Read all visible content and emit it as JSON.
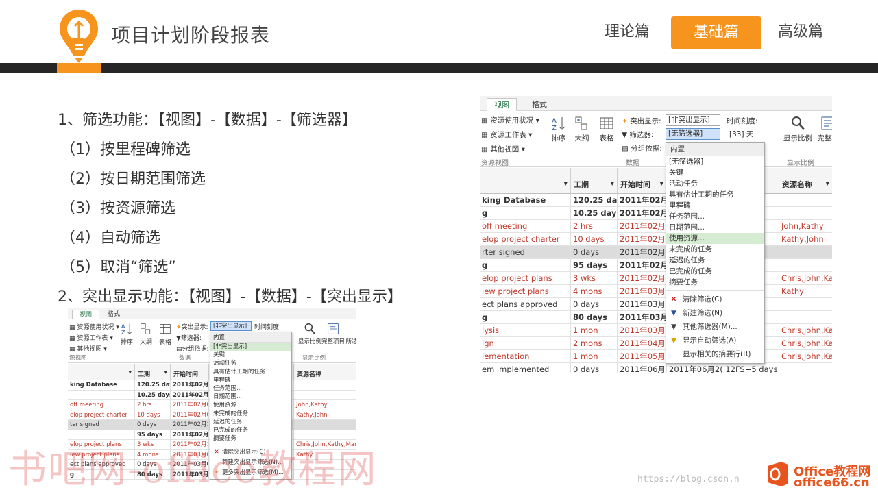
{
  "header": {
    "title": "项目计划阶段报表",
    "nav": [
      "理论篇",
      "基础篇",
      "高级篇"
    ],
    "active_nav": "基础篇"
  },
  "colors": {
    "accent": "#f7941d",
    "band": "#262626",
    "task_red": "#c0392b"
  },
  "content": {
    "line1": "1、筛选功能：【视图】-【数据】-【筛选器】",
    "sub1": "（1）按里程碑筛选",
    "sub2": "（2）按日期范围筛选",
    "sub3": "（3）按资源筛选",
    "sub4": "（4）自动筛选",
    "sub5": "（5）取消“筛选”",
    "line2": "2、突出显示功能：【视图】-【数据】-【突出显示】"
  },
  "shot1": {
    "tabs": [
      "视图",
      "格式"
    ],
    "ribbon": {
      "res_usage": "资源使用状况",
      "res_sheet": "资源工作表",
      "other_views": "其他视图",
      "res_group": "资源视图",
      "sort": "排序",
      "outline": "大纲",
      "tables": "表格",
      "highlight": "突出显示:",
      "highlight_val": "[非突出显示]",
      "filter": "筛选器:",
      "filter_val": "[无筛选器]",
      "groupby": "分组依据:",
      "data_group": "数据",
      "timescale": "时间刻度:",
      "timescale_val": "[33] 天",
      "zoom": "显示比例",
      "complete": "完整项",
      "zoom_group": "显示比例"
    },
    "columns": [
      "工期",
      "开始时间",
      "资源名称"
    ],
    "rows": [
      {
        "name": "king Database",
        "dur": "120.25 day:",
        "start": "2011年02月",
        "res": "",
        "style": "bold"
      },
      {
        "name": "g",
        "dur": "10.25 days",
        "start": "2011年02月0",
        "res": "",
        "style": "bold"
      },
      {
        "name": "off meeting",
        "dur": "2 hrs",
        "start": "2011年02月0",
        "res": "John,Kathy",
        "style": "red"
      },
      {
        "name": "elop project charter",
        "dur": "10 days",
        "start": "2011年02月0",
        "res": "Kathy,John",
        "style": "red"
      },
      {
        "name": "rter signed",
        "dur": "0 days",
        "start": "2011年02月1",
        "res": "",
        "style": "hl"
      },
      {
        "name": "g",
        "dur": "95 days",
        "start": "2011年02月1",
        "res": "",
        "style": "bold"
      },
      {
        "name": "elop project plans",
        "dur": "3 wks",
        "start": "2011年02月1",
        "res": "Chris,John,Kat",
        "style": "red"
      },
      {
        "name": "iew project plans",
        "dur": "4 mons",
        "start": "2011年03月0",
        "res": "Kathy",
        "style": "red"
      },
      {
        "name": "ect plans approved",
        "dur": "0 days",
        "start": "2011年03月0",
        "res": "",
        "style": "normal"
      },
      {
        "name": "g",
        "dur": "80 days",
        "start": "2011年03月0",
        "res": "",
        "style": "bold"
      },
      {
        "name": "lysis",
        "dur": "1 mon",
        "start": "2011年03月0",
        "res": "Chris,John,Kat",
        "style": "red"
      },
      {
        "name": "ign",
        "dur": "2 mons",
        "start": "2011年04月0",
        "res": "Chris,John,Kat",
        "style": "red"
      },
      {
        "name": "lementation",
        "dur": "1 mon",
        "start": "2011年05月2",
        "res": "Chris,John,Kat",
        "style": "red"
      },
      {
        "name": "em implemented",
        "dur": "0 days",
        "start": "2011年06月28",
        "res": "",
        "style": "normal",
        "extra": "2011年06月2( 12FS+5 days"
      }
    ],
    "dropdown": {
      "header": "内置",
      "items": [
        "[无筛选器]",
        "关键",
        "活动任务",
        "具有估计工期的任务",
        "里程碑",
        "任务范围...",
        "日期范围...",
        "使用资源...",
        "未完成的任务",
        "延迟的任务",
        "已完成的任务",
        "摘要任务"
      ],
      "hover": "使用资源...",
      "actions": [
        "清除筛选(C)",
        "新建筛选(N)",
        "其他筛选器(M)...",
        "显示自动筛选(A)",
        "显示相关的摘要行(R)"
      ]
    }
  },
  "shot2": {
    "tabs": [
      "视图",
      "格式"
    ],
    "ribbon": {
      "res_usage": "资源使用状况",
      "res_sheet": "资源工作表",
      "other_views": "其他视图",
      "res_group": "源视图",
      "sort": "排序",
      "outline": "大纲",
      "tables": "表格",
      "highlight": "突出显示:",
      "highlight_val": "[非突出显示]",
      "filter": "筛选器:",
      "groupby": "分组依据:",
      "data_group": "数据",
      "timescale": "时间刻度:",
      "zoom": "显示比例",
      "complete": "完整项目",
      "selected": "所选",
      "zoom_group": "显示比例"
    },
    "columns": [
      "工期",
      "开始时间",
      "资源名称"
    ],
    "rows": [
      {
        "name": "king Database",
        "dur": "120.25 day:",
        "start": "2011年02月",
        "res": "",
        "style": "bold"
      },
      {
        "name": "",
        "dur": "10.25 days",
        "start": "2011年02月0",
        "res": "",
        "style": "bold"
      },
      {
        "name": "off meeting",
        "dur": "2 hrs",
        "start": "2011年02月0",
        "res": "John,Kathy",
        "style": "red"
      },
      {
        "name": "elop project charter",
        "dur": "10 days",
        "start": "2011年02月0",
        "res": "Kathy,John",
        "style": "red"
      },
      {
        "name": "ter signed",
        "dur": "0 days",
        "start": "2011年02月1",
        "res": "",
        "style": "hl"
      },
      {
        "name": "",
        "dur": "95 days",
        "start": "2011年02月1",
        "res": "",
        "style": "bold"
      },
      {
        "name": "elop project plans",
        "dur": "3 wks",
        "start": "2011年02月1",
        "res": "Chris,John,Kathy,Mar",
        "style": "red"
      },
      {
        "name": "iew project plans",
        "dur": "4 mons",
        "start": "2011年03月0",
        "res": "Kathy",
        "style": "red"
      },
      {
        "name": "ect plans approved",
        "dur": "0 days",
        "start": "2011年03月0",
        "res": "",
        "style": "normal"
      },
      {
        "name": "g",
        "dur": "80 days",
        "start": "2011年03月0",
        "res": "",
        "style": "bold"
      }
    ],
    "dropdown": {
      "header": "内置",
      "items": [
        "[非突出显示]",
        "关键",
        "活动任务",
        "具有估计工期的任务",
        "里程碑",
        "任务范围...",
        "日期范围...",
        "使用资源...",
        "未完成的任务",
        "延迟的任务",
        "已完成的任务",
        "摘要任务"
      ],
      "hover": "[非突出显示]",
      "actions": [
        "清除突出显示(C)",
        "新建突出显示筛选(N)...",
        "更多突出显示筛选(M)..."
      ]
    }
  },
  "watermark": {
    "text": "书吧网-office教程网",
    "csdn": "https://blog.csdn.n",
    "brand1": "Office教程网",
    "brand2": "office66.cn"
  }
}
